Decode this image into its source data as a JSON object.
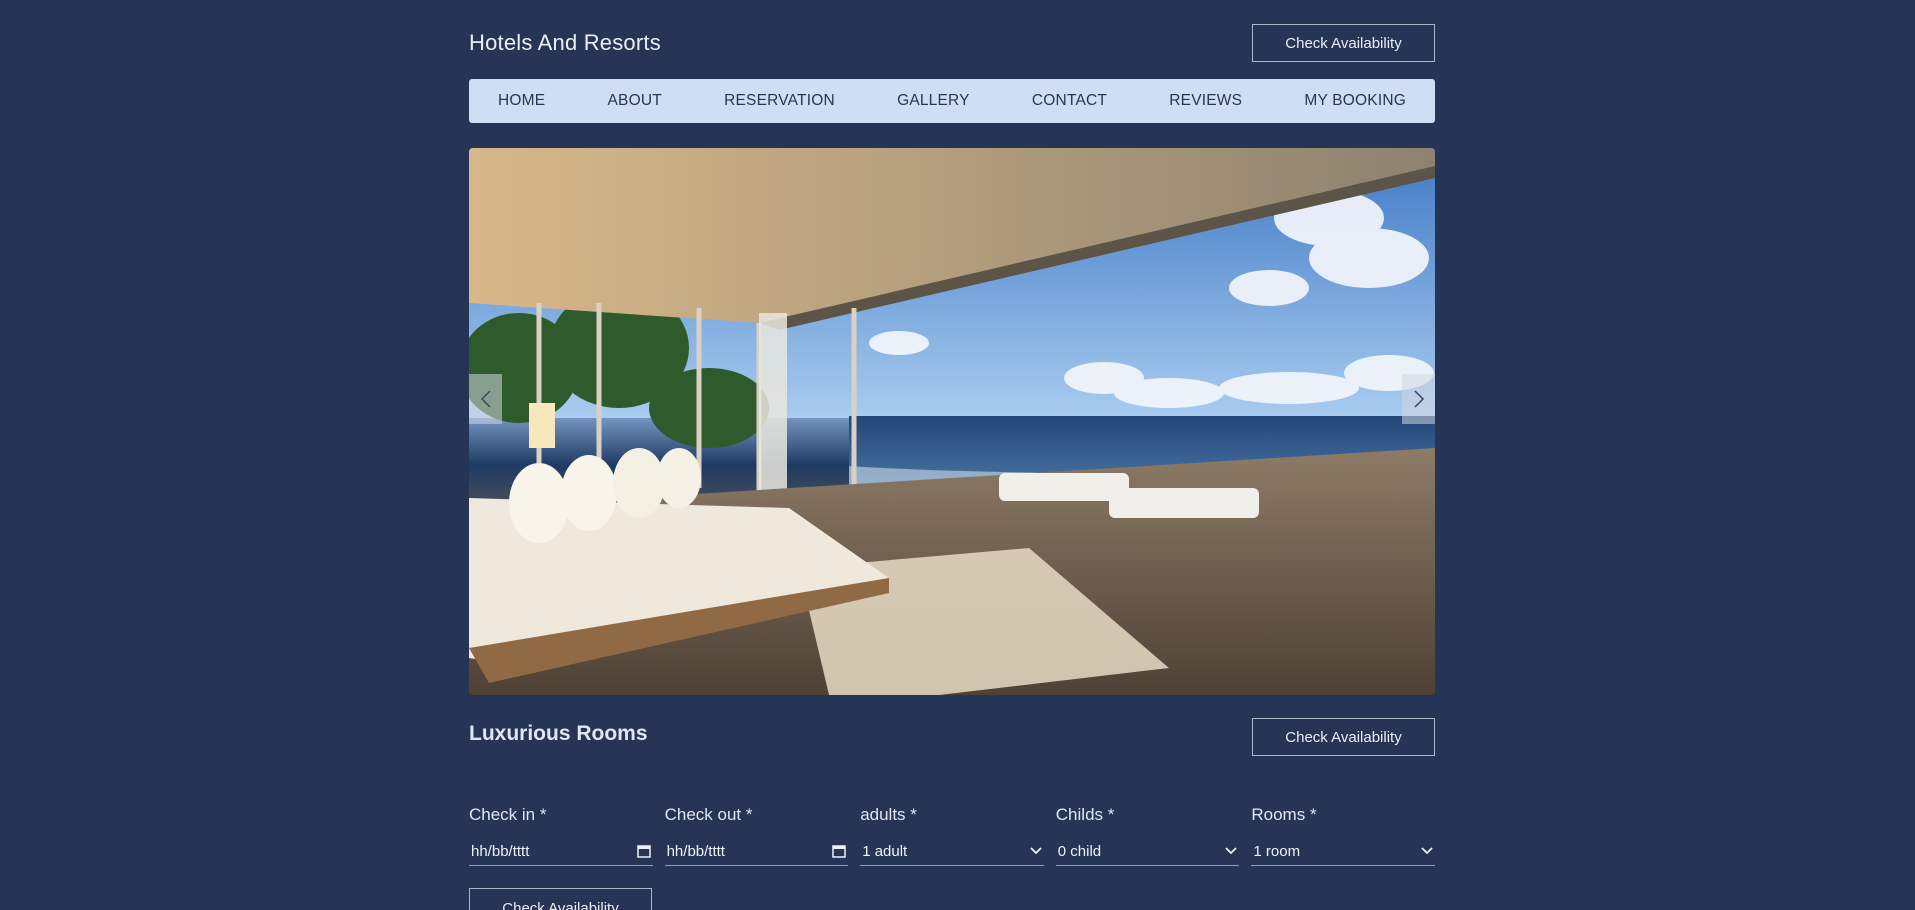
{
  "header": {
    "site_title": "Hotels And Resorts",
    "check_availability_label": "Check Availability"
  },
  "nav": {
    "items": [
      {
        "label": "HOME"
      },
      {
        "label": "ABOUT"
      },
      {
        "label": "RESERVATION"
      },
      {
        "label": "GALLERY"
      },
      {
        "label": "CONTACT"
      },
      {
        "label": "REVIEWS"
      },
      {
        "label": "MY BOOKING"
      }
    ]
  },
  "hero": {
    "image_subject": "luxury bedroom with ocean view",
    "prev_icon": "chevron-left-icon",
    "next_icon": "chevron-right-icon"
  },
  "section": {
    "title": "Luxurious Rooms",
    "check_availability_label": "Check Availability"
  },
  "form": {
    "check_in": {
      "label": "Check in *",
      "value": "hh/bb/tttt",
      "icon": "calendar-icon"
    },
    "check_out": {
      "label": "Check out *",
      "value": "hh/bb/tttt",
      "icon": "calendar-icon"
    },
    "adults": {
      "label": "adults *",
      "value": "1 adult",
      "icon": "chevron-down-icon"
    },
    "childs": {
      "label": "Childs *",
      "value": "0 child",
      "icon": "chevron-down-icon"
    },
    "rooms": {
      "label": "Rooms *",
      "value": "1 room",
      "icon": "chevron-down-icon"
    },
    "submit_label": "Check Availability"
  },
  "colors": {
    "background": "#263455",
    "nav_background": "#cfdef5",
    "nav_text": "#2a3550",
    "text": "#e6ecf7"
  }
}
